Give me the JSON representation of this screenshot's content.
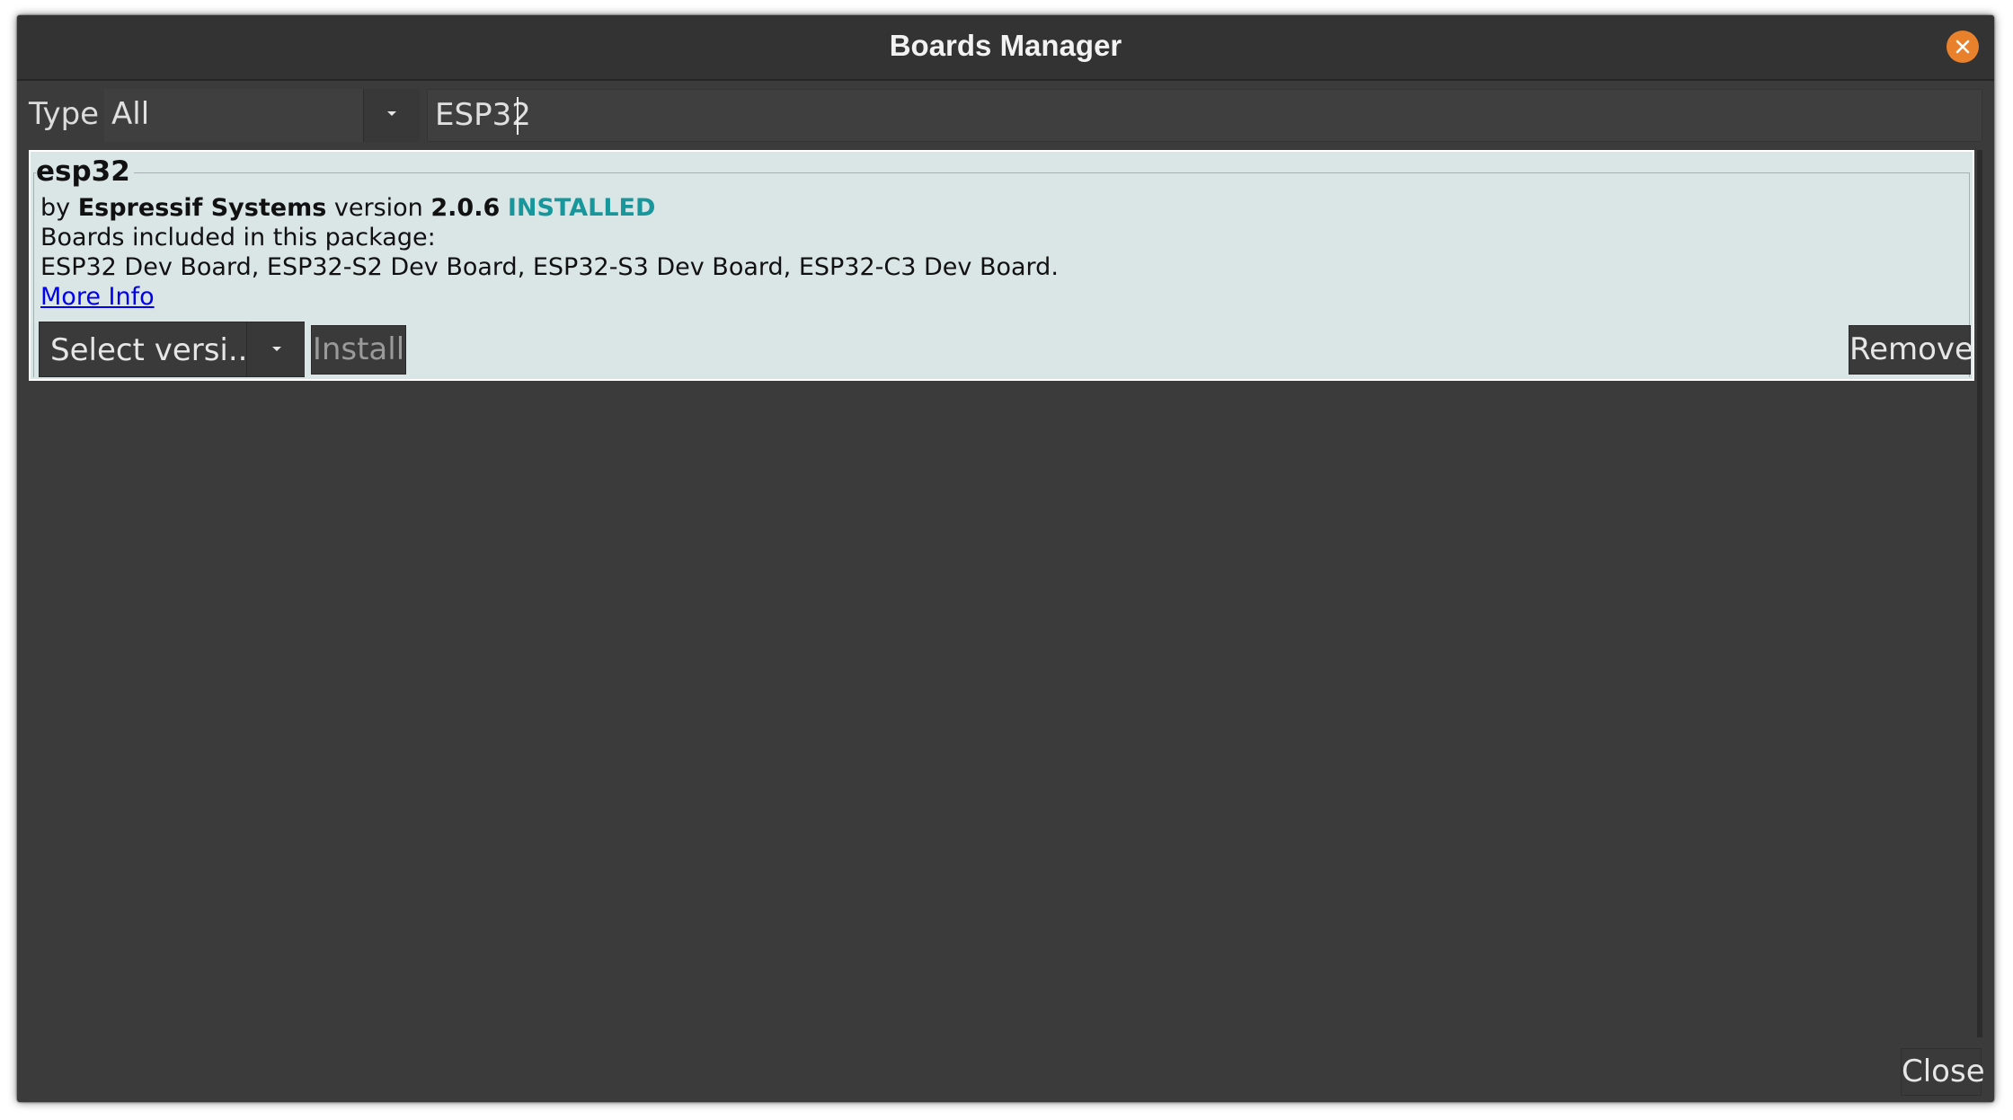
{
  "window": {
    "title": "Boards Manager"
  },
  "filter": {
    "type_label": "Type",
    "type_value": "All",
    "search_value": "ESP32"
  },
  "package": {
    "name": "esp32",
    "by": "by",
    "author": "Espressif Systems",
    "version_label": "version",
    "version": "2.0.6",
    "status": "INSTALLED",
    "boards_heading": "Boards included in this package:",
    "boards_list": "ESP32 Dev Board, ESP32-S2 Dev Board, ESP32-S3 Dev Board, ESP32-C3 Dev Board.",
    "more_info": "More Info",
    "select_version": "Select versi...",
    "install_label": "Install",
    "remove_label": "Remove"
  },
  "footer": {
    "close_label": "Close"
  },
  "colors": {
    "installed": "#17979b",
    "close_icon_bg": "#e9812c",
    "card_bg": "#dae5e6",
    "window_bg": "#3b3b3b"
  },
  "icons": [
    "close-circle-icon",
    "chevron-down-icon"
  ]
}
